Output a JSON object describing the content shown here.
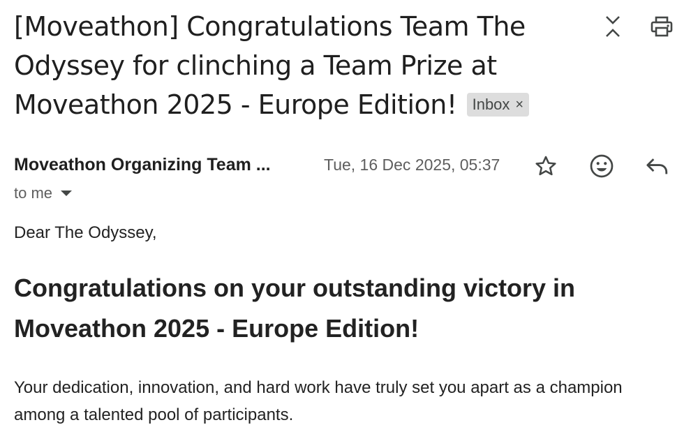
{
  "email": {
    "subject": "[Moveathon] Congratulations Team The Odyssey for clinching a Team Prize at Moveathon 2025 - Europe Edition!",
    "label": "Inbox",
    "label_remove": "×",
    "sender": "Moveathon Organizing Team ...",
    "date": "Tue, 16 Dec 2025, 05:37",
    "recipient": "to me"
  },
  "body": {
    "greeting": "Dear The Odyssey,",
    "headline": "Congratulations on your outstanding victory in Moveathon 2025 - Europe Edition!",
    "paragraph": "Your dedication, innovation, and hard work have truly set you apart as a champion among a talented pool of participants."
  },
  "icons": {
    "expand_collapse": "expand-collapse-icon",
    "print": "printer-icon",
    "star": "star-icon",
    "emoji": "emoji-reaction-icon",
    "reply": "reply-icon"
  },
  "colors": {
    "text_primary": "#1f1f1f",
    "text_secondary": "#5e5e5e",
    "chip_background": "#dddddd"
  }
}
